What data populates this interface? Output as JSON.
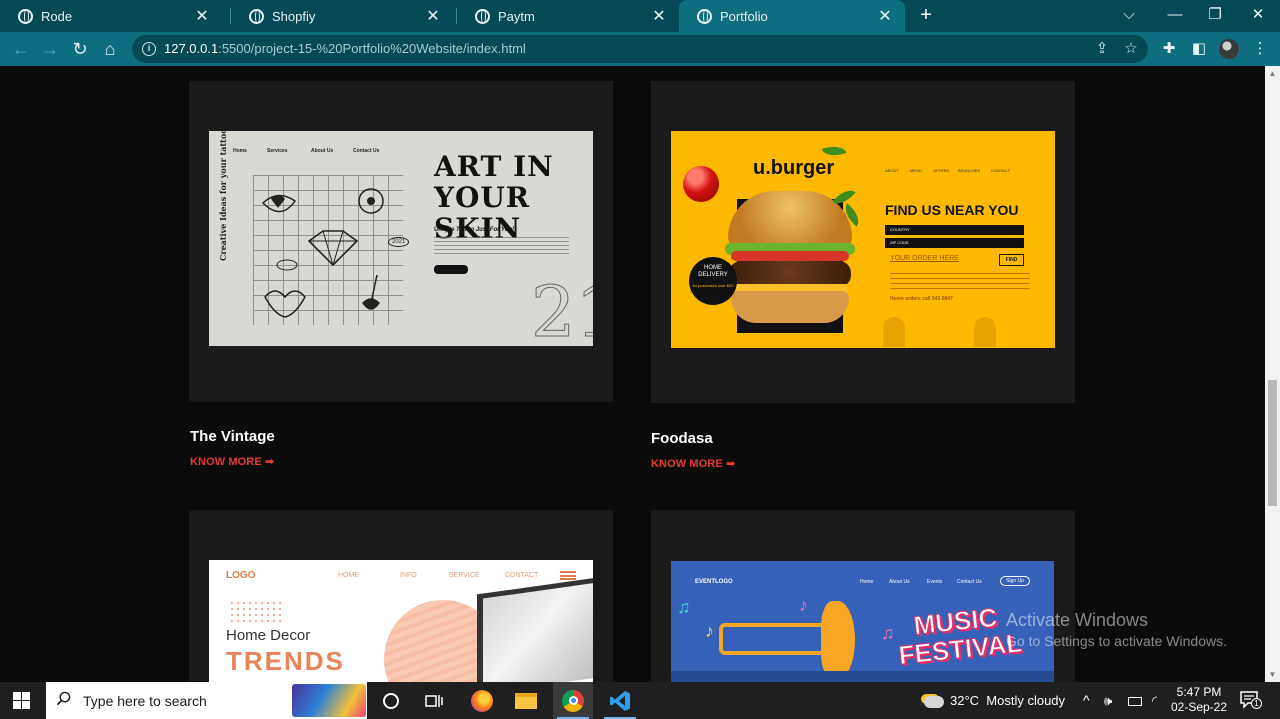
{
  "browser": {
    "tabs": [
      {
        "title": "Rode",
        "active": false
      },
      {
        "title": "Shopfiy",
        "active": false
      },
      {
        "title": "Paytm",
        "active": false
      },
      {
        "title": "Portfolio",
        "active": true
      }
    ],
    "url_host": "127.0.0.1",
    "url_rest": ":5500/project-15-%20Portfolio%20Website/index.html"
  },
  "projects": [
    {
      "title": "The Vintage",
      "cta": "KNOW MORE ➡",
      "mockup": {
        "nav": [
          "Home",
          "Services",
          "About Us",
          "Contact Us"
        ],
        "headline_1": "ART IN",
        "headline_2": "YOUR SKIN",
        "subtitle": "Unique Tattoo Just For You!",
        "side_text": "Creative Ideas for your tattoo",
        "year": "2021",
        "big_number": "21"
      }
    },
    {
      "title": "Foodasa",
      "cta": "KNOW MORE ➡",
      "mockup": {
        "logo": "u.burger",
        "nav": [
          "ABOUT",
          "MENU",
          "OFFERS",
          "BRANCHES",
          "CONTACT"
        ],
        "headline": "FIND US NEAR YOU",
        "field_1": "COUNTRY",
        "field_2": "ZIP CODE",
        "order_link": "YOUR ORDER HERE",
        "find_button": "FIND",
        "call": "Home orders call 543 0847",
        "badge_title": "HOME DELIVERY",
        "badge_sub": "for purchases over $20"
      }
    },
    {
      "title": "",
      "cta": "",
      "mockup": {
        "logo": "LOGO",
        "nav": [
          "HOME",
          "INFO",
          "SERVICE",
          "CONTACT"
        ],
        "headline_1": "Home  Decor",
        "headline_2": "TRENDS"
      }
    },
    {
      "title": "",
      "cta": "",
      "mockup": {
        "logo": "EVENTLOGO",
        "nav": [
          "Home",
          "About Us",
          "Events",
          "Contact Us"
        ],
        "signup": "Sign Up",
        "headline_1": "MUSIC",
        "headline_2": "FESTIVAL"
      }
    }
  ],
  "watermark": {
    "line_1": "Activate Windows",
    "line_2": "Go to Settings to activate Windows."
  },
  "taskbar": {
    "search_placeholder": "Type here to search",
    "temperature": "32°C",
    "weather": "Mostly cloudy",
    "time": "5:47 PM",
    "date": "02-Sep-22",
    "notification_count": "1"
  },
  "colors": {
    "tab_strip": "#054956",
    "toolbar": "#0e6d7e",
    "page_bg": "#0b0b0b",
    "card_bg": "#1a1a1a",
    "cta": "#e43b32"
  }
}
